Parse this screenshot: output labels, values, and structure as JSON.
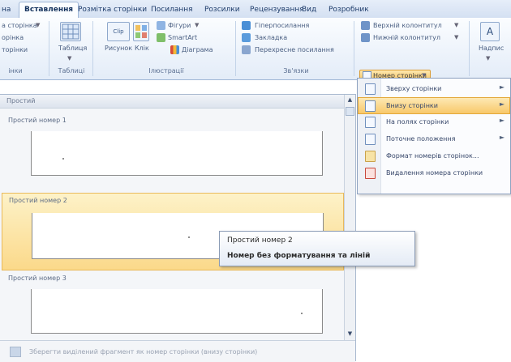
{
  "tabs": {
    "partial_left": "на",
    "insert": "Вставлення",
    "page_layout": "Розмітка сторінки",
    "references": "Посилання",
    "mailings": "Розсилки",
    "review": "Рецензування",
    "view": "Вид",
    "developer": "Розробник"
  },
  "ribbon": {
    "pages_items": [
      "а сторінка",
      "орінка",
      "торінки"
    ],
    "pages_group": "інки",
    "table_label": "Таблиця",
    "tables_group": "Таблиці",
    "picture_label": "Рисунок",
    "clip_label": "Клік",
    "clip_icon_text": "Clip",
    "shapes_label": "Фігури",
    "smartart_label": "SmartArt",
    "chart_label": "Діаграма",
    "illustrations_group": "Ілюстрації",
    "hyperlink_label": "Гіперпосилання",
    "bookmark_label": "Закладка",
    "crossref_label": "Перехресне посилання",
    "links_group": "Зв'язки",
    "header_label": "Верхній колонтитул",
    "footer_label": "Нижній колонтитул",
    "page_number_label": "Номер сторінки",
    "textbox_label": "Надпис",
    "textbox_icon_text": "A"
  },
  "menu": {
    "items": [
      {
        "label": "Зверху сторінки",
        "arrow": "►"
      },
      {
        "label": "Внизу сторінки",
        "arrow": "►"
      },
      {
        "label": "На полях сторінки",
        "arrow": "►"
      },
      {
        "label": "Поточне положення",
        "arrow": "►"
      },
      {
        "label": "Формат номерів сторінок...",
        "arrow": ""
      },
      {
        "label": "Видалення номера сторінки",
        "arrow": ""
      }
    ]
  },
  "gallery": {
    "header": "Простий",
    "items": [
      "Простий номер 1",
      "Простий номер 2",
      "Простий номер 3"
    ],
    "footer": "Зберегти виділений фрагмент як номер сторінки (внизу сторінки)"
  },
  "tooltip": {
    "title": "Простий номер 2",
    "desc": "Номер без форматування та ліній"
  },
  "colors": {
    "ribbon": "#e3ecf8",
    "highlight": "#f8c86a",
    "text": "#37476a"
  }
}
